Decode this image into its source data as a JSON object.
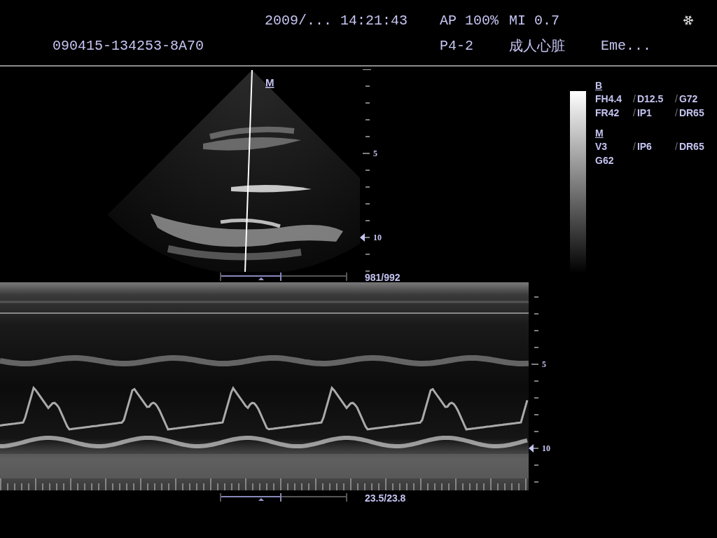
{
  "header": {
    "date": "2009/...",
    "time": "14:21:43",
    "acoustic_power": "AP 100%",
    "mechanical_index": "MI 0.7",
    "patient_id": "090415-134253-8A70",
    "probe": "P4-2",
    "exam": "成人心脏",
    "operator": "Eme..."
  },
  "b_mode": {
    "marker": "M",
    "depth_labels": [
      {
        "label": "5",
        "focus": false
      },
      {
        "label": "10",
        "focus": true
      }
    ],
    "frame_counter": "981/992"
  },
  "parameters": [
    {
      "title": "B",
      "rows": [
        [
          {
            "value": "FH4.4"
          },
          {
            "sep": "/",
            "value": "D12.5"
          },
          {
            "sep": "/",
            "value": "G72"
          }
        ],
        [
          {
            "value": "FR42"
          },
          {
            "sep": "/",
            "value": "IP1"
          },
          {
            "sep": "/",
            "value": "DR65"
          }
        ]
      ]
    },
    {
      "title": "M",
      "rows": [
        [
          {
            "value": "V3"
          },
          {
            "sep": "/",
            "value": "IP6"
          },
          {
            "sep": "/",
            "value": "DR65"
          }
        ],
        [
          {
            "value": "G62"
          }
        ]
      ]
    }
  ],
  "m_mode": {
    "depth_labels": [
      {
        "label": "5",
        "focus": false
      },
      {
        "label": "10",
        "focus": true
      }
    ],
    "time_counter": "23.5/23.8"
  }
}
